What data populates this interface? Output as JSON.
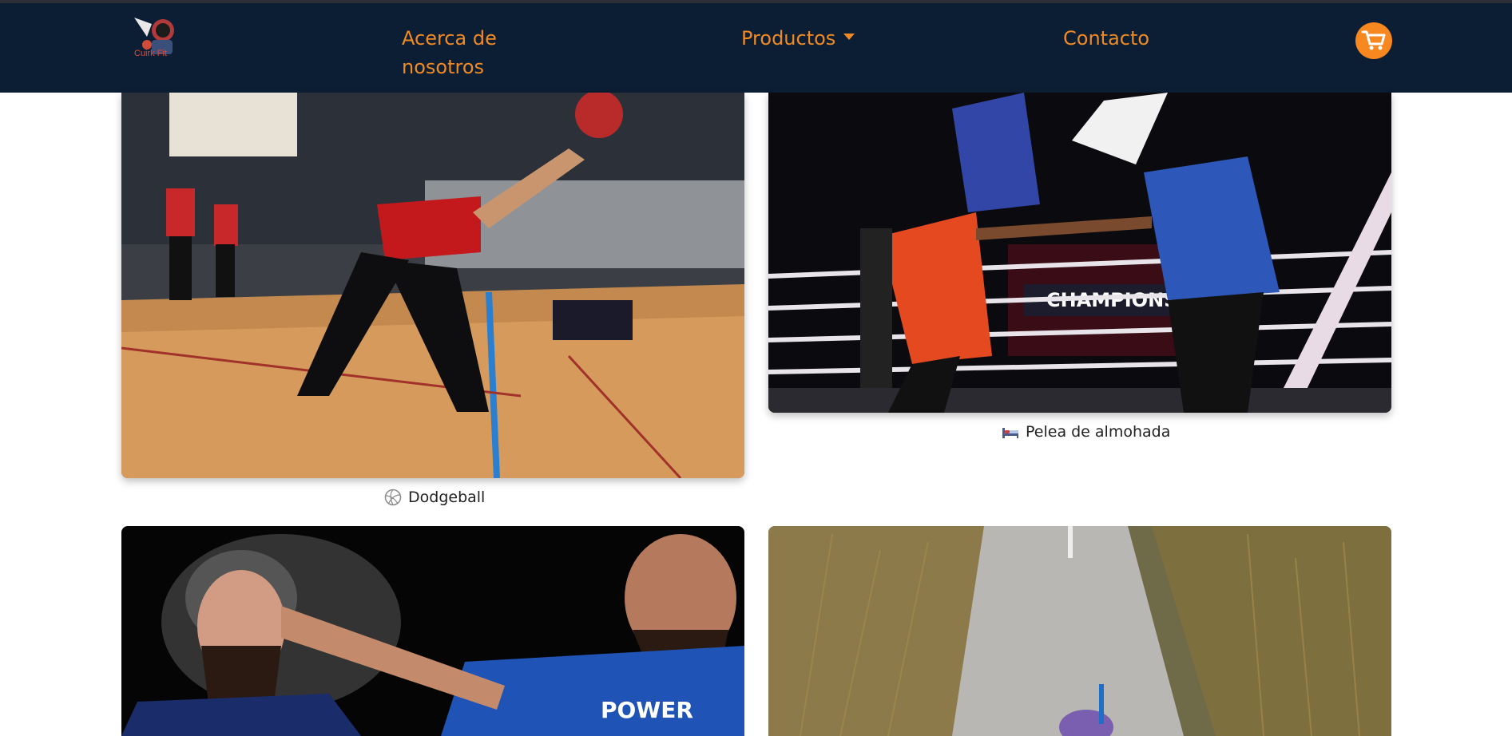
{
  "nav": {
    "logo_alt": "Cuirk Fit",
    "about_label": "Acerca de nosotros",
    "products_label": "Productos",
    "contact_label": "Contacto",
    "cart_icon": "shopping-cart-icon"
  },
  "colors": {
    "navbar": "#0c1e33",
    "accent": "#f08a24"
  },
  "cards": [
    {
      "caption": "Dodgeball",
      "icon": "volleyball-icon"
    },
    {
      "caption": "Pelea de almohada",
      "icon": "bed-icon"
    },
    {
      "caption": "",
      "icon": ""
    },
    {
      "caption": "",
      "icon": ""
    }
  ]
}
